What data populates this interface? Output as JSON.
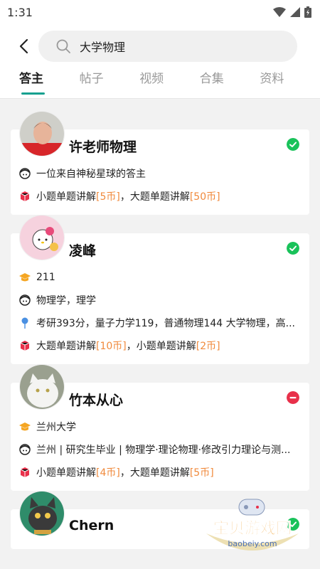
{
  "status_bar": {
    "time": "1:31"
  },
  "search": {
    "query": "大学物理"
  },
  "tabs": [
    {
      "label": "答主",
      "active": true
    },
    {
      "label": "帖子",
      "active": false
    },
    {
      "label": "视频",
      "active": false
    },
    {
      "label": "合集",
      "active": false
    },
    {
      "label": "资料",
      "active": false
    }
  ],
  "answerers": [
    {
      "name": "许老师物理",
      "status": "online",
      "bio": "一位来自神秘星球的答主",
      "pricing": [
        {
          "prefix": "小题单题讲解",
          "price": "[5币]",
          "sep": "，"
        },
        {
          "prefix": "大题单题讲解",
          "price": "[50币]",
          "sep": ""
        }
      ]
    },
    {
      "name": "凌峰",
      "status": "online",
      "school": "211",
      "field": "物理学，理学",
      "scores": "考研393分，量子力学119，普通物理144 大学物理，高...",
      "pricing": [
        {
          "prefix": "大题单题讲解",
          "price": "[10币]",
          "sep": "，"
        },
        {
          "prefix": "小题单题讲解",
          "price": "[2币]",
          "sep": ""
        }
      ]
    },
    {
      "name": "竹本从心",
      "status": "busy",
      "school": "兰州大学",
      "field": "兰州 | 研究生毕业 | 物理学·理论物理·修改引力理论与测...",
      "pricing": [
        {
          "prefix": "小题单题讲解",
          "price": "[4币]",
          "sep": "，"
        },
        {
          "prefix": "大题单题讲解",
          "price": "[5币]",
          "sep": ""
        }
      ]
    },
    {
      "name": "Chern",
      "status": "online"
    }
  ],
  "watermark": {
    "title": "宝贝游戏网",
    "url": "baobeiy.com"
  },
  "colors": {
    "accent": "#15a08f",
    "online": "#19c25a",
    "busy": "#e8304a",
    "price": "#f08a3c"
  }
}
